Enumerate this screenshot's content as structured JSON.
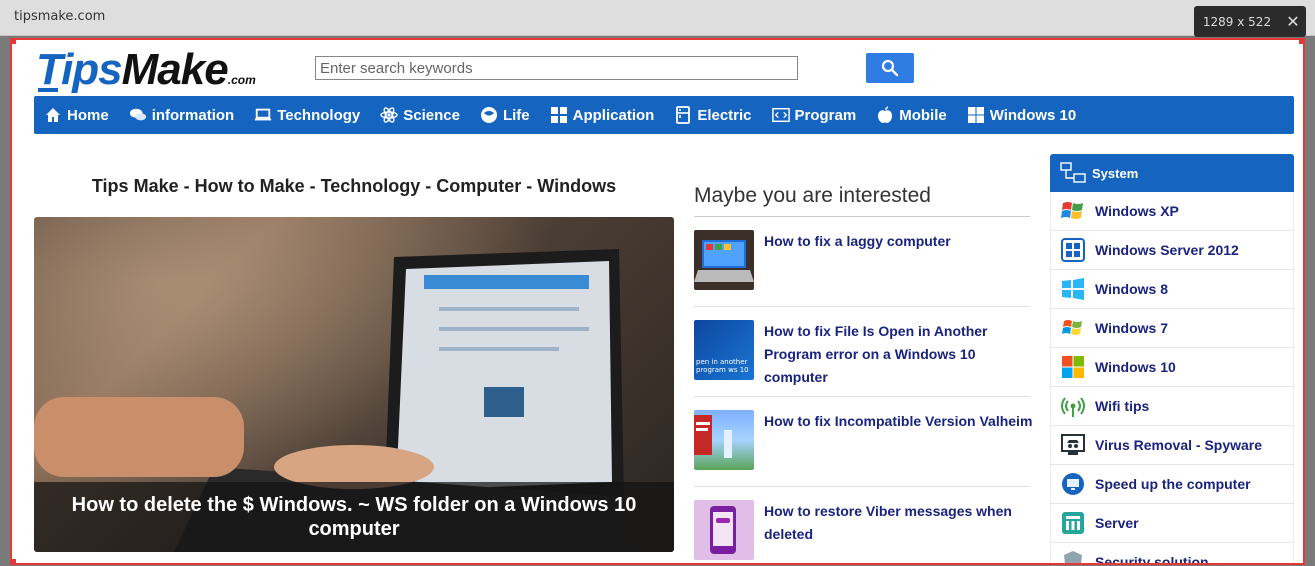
{
  "browser": {
    "url": "tipsmake.com",
    "dimensions": "1289 x 522",
    "close_glyph": "✕"
  },
  "header": {
    "logo_tips": "Tips",
    "logo_make": "Make",
    "logo_com": ".com",
    "search_placeholder": "Enter search keywords"
  },
  "nav": {
    "items": [
      {
        "label": "Home",
        "icon": "home-icon"
      },
      {
        "label": "information",
        "icon": "chat-icon"
      },
      {
        "label": "Technology",
        "icon": "laptop-icon"
      },
      {
        "label": "Science",
        "icon": "atom-icon"
      },
      {
        "label": "Life",
        "icon": "globe-icon"
      },
      {
        "label": "Application",
        "icon": "apps-icon"
      },
      {
        "label": "Electric",
        "icon": "fridge-icon"
      },
      {
        "label": "Program",
        "icon": "code-icon"
      },
      {
        "label": "Mobile",
        "icon": "apple-icon"
      },
      {
        "label": "Windows 10",
        "icon": "windows-icon"
      }
    ]
  },
  "main": {
    "title": "Tips Make - How to Make - Technology - Computer - Windows",
    "hero_caption": "How to delete the $ Windows. ~ WS folder on a Windows 10 computer"
  },
  "interested": {
    "heading": "Maybe you are interested",
    "articles": [
      {
        "title": "How to fix a laggy computer"
      },
      {
        "title": "How to fix File Is Open in Another Program error on a Windows 10 computer",
        "thumb_text": "pen in another program ws 10"
      },
      {
        "title": "How to fix Incompatible Version Valheim"
      },
      {
        "title": "How to restore Viber messages when deleted"
      }
    ]
  },
  "sidebar": {
    "heading": "System",
    "items": [
      {
        "label": "Windows XP",
        "icon": "windows-xp-icon"
      },
      {
        "label": "Windows Server 2012",
        "icon": "windows-server-icon"
      },
      {
        "label": "Windows 8",
        "icon": "windows-8-icon"
      },
      {
        "label": "Windows 7",
        "icon": "windows-7-icon"
      },
      {
        "label": "Windows 10",
        "icon": "windows-10-icon"
      },
      {
        "label": "Wifi tips",
        "icon": "wifi-icon"
      },
      {
        "label": "Virus Removal - Spyware",
        "icon": "spy-icon"
      },
      {
        "label": "Speed up the computer",
        "icon": "monitor-icon"
      },
      {
        "label": "Server",
        "icon": "server-icon"
      },
      {
        "label": "Security solution",
        "icon": "shield-icon"
      }
    ]
  },
  "colors": {
    "brand_blue": "#1565c0",
    "link_navy": "#1a237e",
    "frame_red": "#e53935"
  }
}
